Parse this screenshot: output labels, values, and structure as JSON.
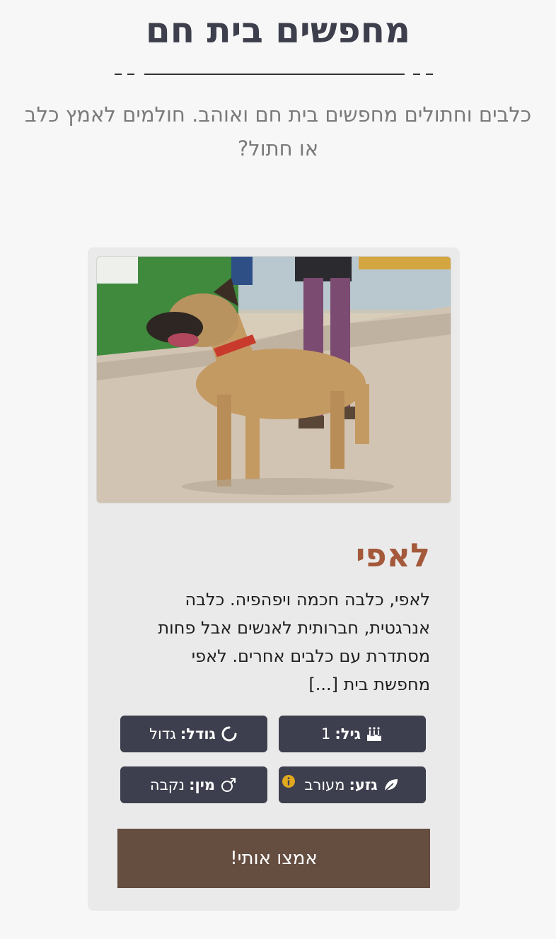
{
  "header": {
    "title": "מחפשים בית חם",
    "intro_line1": "כלבים וחתולים מחפשים בית חם ואוהב. חולמים לאמץ כלב",
    "intro_line2": "או חתול?"
  },
  "card": {
    "name": "לאפי",
    "description_lines": [
      "לאפי, כלבה חכמה ויפהפיה. כלבה",
      "אנרגטית, חברותית לאנשים אבל פחות",
      "מסתדרת עם כלבים אחרים. לאפי",
      "מחפשת בית [...]"
    ],
    "badges": {
      "age": {
        "label": "גיל:",
        "value": "1",
        "icon": "birthday-cake-icon"
      },
      "size": {
        "label": "גודל:",
        "value": "גדול",
        "icon": "circle-notch-icon"
      },
      "breed": {
        "label": "גזע:",
        "value": "מעורב",
        "icon": "leaf-icon"
      },
      "sex": {
        "label": "מין:",
        "value": "נקבה",
        "icon": "mars-icon"
      }
    },
    "adopt_label": "אמצו אותי!"
  },
  "colors": {
    "title": "#3d3f4d",
    "name": "#a4593a",
    "badge_bg": "#3e3f4e",
    "button_bg": "#654d40",
    "info_icon": "#e0a81e"
  }
}
